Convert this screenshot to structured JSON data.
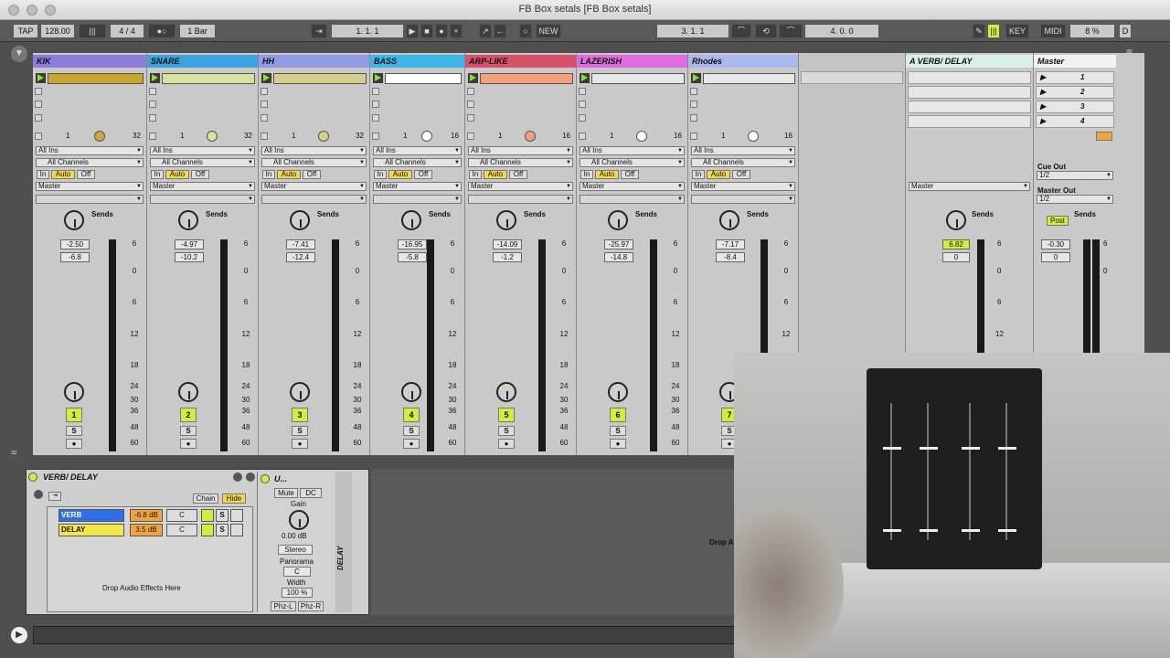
{
  "window": {
    "title": "FB Box setals  [FB Box setals]"
  },
  "transport": {
    "tap": "TAP",
    "tempo": "128.00",
    "meter": "4 / 4",
    "quant": "1 Bar",
    "position": "1.   1.   1",
    "new": "NEW",
    "loop_start": "3.   1.   1",
    "loop_len": "4.   0.   0",
    "key": "KEY",
    "midi": "MIDI",
    "cpu": "8 %",
    "d": "D"
  },
  "tracks": [
    {
      "name": "KIK",
      "color": "#8f7bd9",
      "clip": "#c9a629",
      "num": "1",
      "range": "32",
      "vol": "-2.50",
      "peak": "-6.8",
      "pan_knob": "#d9a23a"
    },
    {
      "name": "SNARE",
      "color": "#3aa3e0",
      "clip": "#d6e39a",
      "num": "2",
      "range": "32",
      "vol": "-4.97",
      "peak": "-10.2",
      "pan_knob": "#d6e39a"
    },
    {
      "name": "HH",
      "color": "#8f9ce3",
      "clip": "#d6cf8a",
      "num": "3",
      "range": "32",
      "vol": "-7.41",
      "peak": "-12.4",
      "pan_knob": "#d6cf8a"
    },
    {
      "name": "BASS",
      "color": "#3ab6e8",
      "clip": "#ffffff",
      "num": "4",
      "range": "16",
      "vol": "-16.95",
      "peak": "-5.8",
      "pan_knob": "#ffffff"
    },
    {
      "name": "ARP-LIKE",
      "color": "#d8506a",
      "clip": "#f5a07a",
      "num": "5",
      "range": "16",
      "vol": "-14.09",
      "peak": "-1.2",
      "pan_knob": "#f5a07a"
    },
    {
      "name": "LAZERISH",
      "color": "#e06ae0",
      "clip": "#e8e8e8",
      "num": "6",
      "range": "16",
      "vol": "-25.97",
      "peak": "-14.8",
      "pan_knob": "#ffffff"
    },
    {
      "name": "Rhodes",
      "color": "#a9b8f0",
      "clip": "#e8e8e8",
      "num": "7",
      "range": "16",
      "vol": "-7.17",
      "peak": "-8.4",
      "pan_knob": "#ffffff"
    }
  ],
  "common": {
    "all_ins": "All Ins",
    "all_channels": "All Channels",
    "in": "In",
    "auto": "Auto",
    "off": "Off",
    "master": "Master",
    "sends": "Sends",
    "solo": "S",
    "slot_one": "1"
  },
  "scale": [
    "6",
    "0",
    "6",
    "12",
    "18",
    "24",
    "30",
    "36",
    "48",
    "60"
  ],
  "ret": {
    "name": "A VERB/ DELAY",
    "vol": "6.82",
    "peak": "0",
    "master": "Master",
    "sends": "Sends"
  },
  "master": {
    "name": "Master",
    "scenes": [
      "1",
      "2",
      "3",
      "4"
    ],
    "cue_out": "Cue Out",
    "cue_val": "1/2",
    "master_out": "Master Out",
    "master_val": "1/2",
    "post": "Post",
    "sends": "Sends",
    "vol": "-0.30",
    "peak": "0"
  },
  "device": {
    "rack_name": "VERB/ DELAY",
    "chain": "Chain",
    "hide": "Hide",
    "rows": [
      {
        "name": "VERB",
        "db": "-6.8 dB",
        "pan": "C"
      },
      {
        "name": "DELAY",
        "db": "3.5 dB",
        "pan": "C"
      }
    ],
    "drop": "Drop Audio Effects Here",
    "utility": "U...",
    "mute": "Mute",
    "dc": "DC",
    "gain": "Gain",
    "gain_val": "0.00 dB",
    "stereo": "Stereo",
    "panorama": "Panorama",
    "pan_val": "C",
    "width": "Width",
    "width_val": "100 %",
    "phzl": "Phz-L",
    "phzr": "Phz-R",
    "side_label": "DELAY",
    "drop2": "Drop A"
  }
}
